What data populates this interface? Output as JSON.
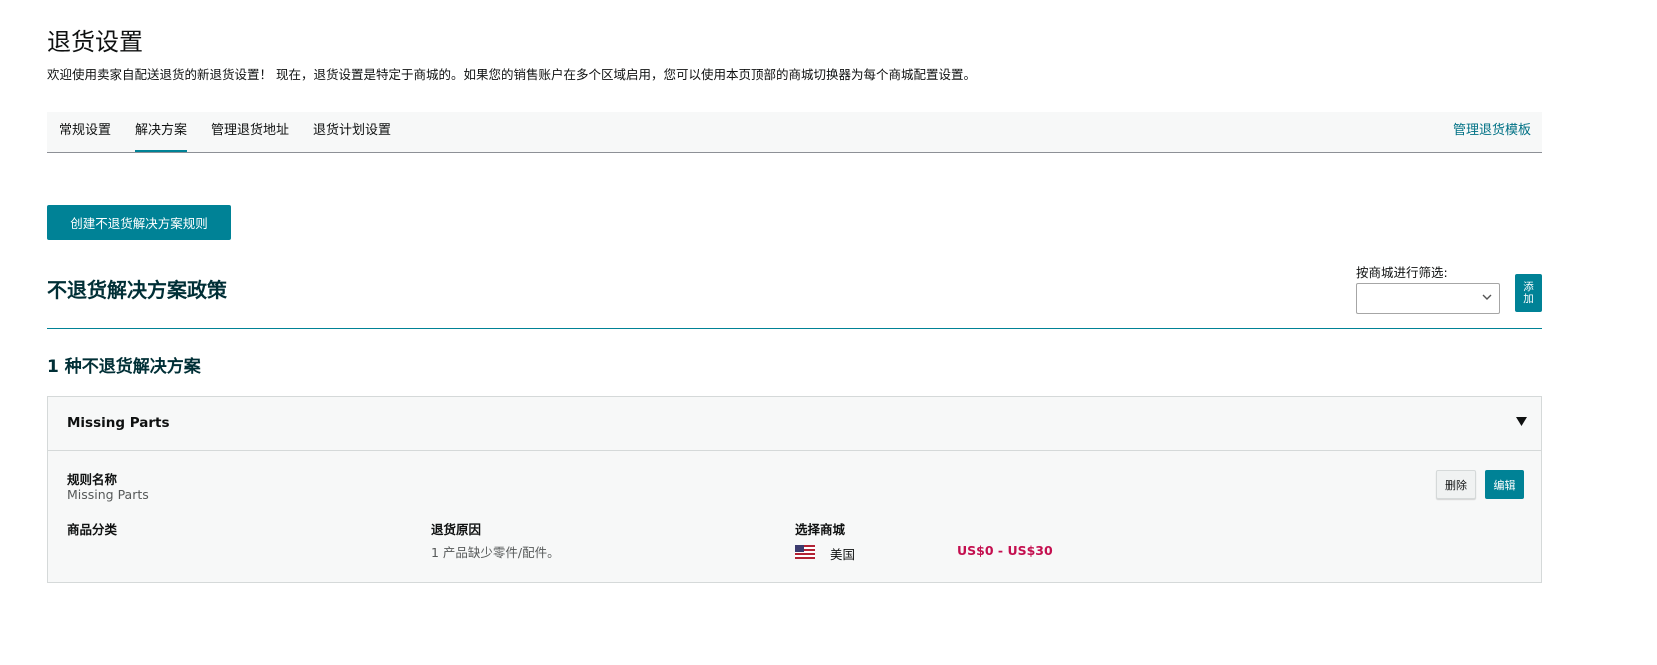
{
  "header": {
    "title": "退货设置",
    "intro": "欢迎使用卖家自配送退货的新退货设置！ 现在，退货设置是特定于商城的。如果您的销售账户在多个区域启用，您可以使用本页顶部的商城切换器为每个商城配置设置。"
  },
  "tabs": [
    {
      "label": "常规设置",
      "active": false
    },
    {
      "label": "解决方案",
      "active": true
    },
    {
      "label": "管理退货地址",
      "active": false
    },
    {
      "label": "退货计划设置",
      "active": false
    }
  ],
  "tab_right_link": "管理退货模板",
  "create_button": "创建不退货解决方案规则",
  "policy_section": {
    "title": "不退货解决方案政策",
    "filter_label": "按商城进行筛选:",
    "filter_value": "",
    "add_button": "添加"
  },
  "count_title": "1 种不退货解决方案",
  "card": {
    "title": "Missing Parts",
    "toggle_icon": "triangle-down-icon",
    "rule_name_label": "规则名称",
    "rule_name_value": "Missing Parts",
    "delete_label": "删除",
    "edit_label": "编辑",
    "col_category_label": "商品分类",
    "col_reason_label": "退货原因",
    "col_reason_value": "1 产品缺少零件/配件。",
    "col_marketplace_label": "选择商城",
    "marketplace": {
      "flag_icon": "us-flag-icon",
      "name": "美国",
      "price_range": "US$0 - US$30"
    }
  },
  "colors": {
    "accent": "#008296",
    "link": "#007185",
    "price": "#c40f4f",
    "heading": "#002f36"
  }
}
